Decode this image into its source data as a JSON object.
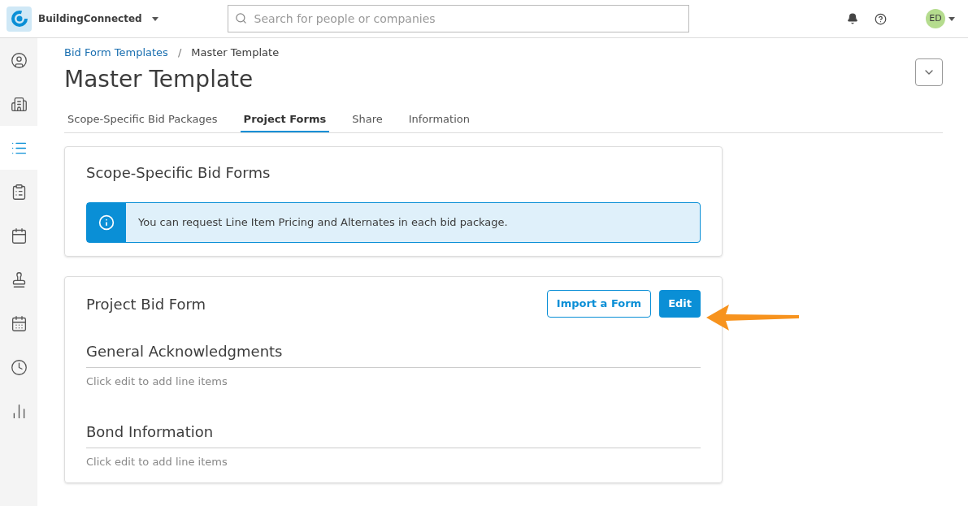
{
  "app": {
    "name": "BuildingConnected"
  },
  "search": {
    "placeholder": "Search for people or companies"
  },
  "user": {
    "initials": "ED"
  },
  "sidebar": {
    "items": [
      {
        "kind": "person",
        "selected": false
      },
      {
        "kind": "building",
        "selected": false
      },
      {
        "kind": "list",
        "selected": true
      },
      {
        "kind": "clipboard",
        "selected": false
      },
      {
        "kind": "calendar",
        "selected": false
      },
      {
        "kind": "stamp",
        "selected": false
      },
      {
        "kind": "calendar-notes",
        "selected": false
      },
      {
        "kind": "clock",
        "selected": false
      },
      {
        "kind": "chart",
        "selected": false
      }
    ]
  },
  "breadcrumb_separator": "/",
  "breadcrumb": [
    {
      "label": "Bid Form Templates",
      "link": true
    },
    {
      "label": "Master Template",
      "link": false
    }
  ],
  "title": "Master Template",
  "tabs": [
    {
      "label": "Scope-Specific Bid Packages",
      "selected": false
    },
    {
      "label": "Project Forms",
      "selected": true
    },
    {
      "label": "Share",
      "selected": false
    },
    {
      "label": "Information",
      "selected": false
    }
  ],
  "scope_card": {
    "title": "Scope-Specific Bid Forms",
    "info": "You can request Line Item Pricing and Alternates in each bid package."
  },
  "bid_form_card": {
    "title": "Project Bid Form",
    "buttons": [
      {
        "label": "Import a Form",
        "kind": "outline"
      },
      {
        "label": "Edit",
        "kind": "primary"
      }
    ],
    "sections": [
      {
        "title": "General Acknowledgments",
        "hint": "Click edit to add line items"
      },
      {
        "title": "Bond Information",
        "hint": "Click edit to add line items"
      }
    ]
  }
}
